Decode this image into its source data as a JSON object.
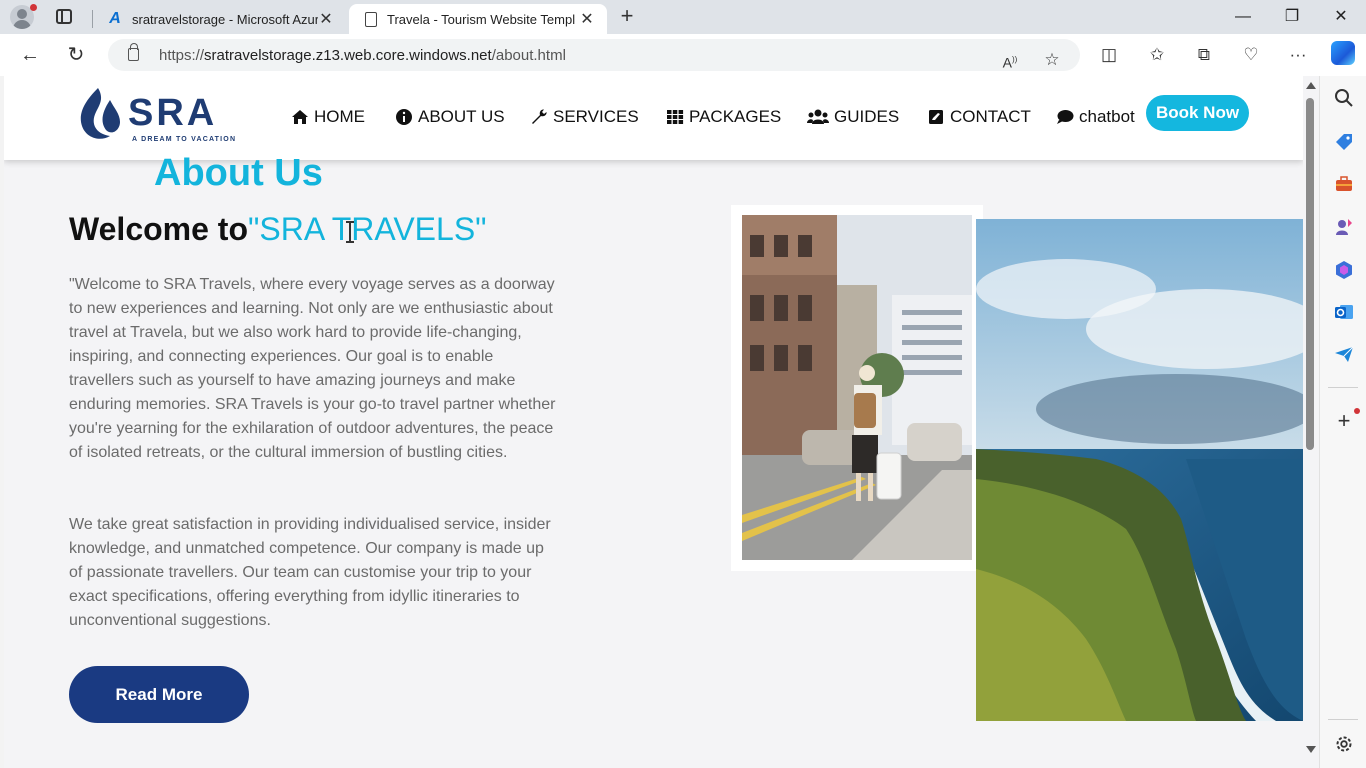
{
  "browser": {
    "tabs": [
      {
        "title": "sratravelstorage - Microsoft Azur",
        "favicon": "azure-icon"
      },
      {
        "title": "Travela - Tourism Website Templ",
        "favicon": "page-icon",
        "active": true
      }
    ],
    "url": {
      "scheme": "https://",
      "host": "sratravelstorage.z13.web.core.windows.net",
      "path": "/about.html"
    }
  },
  "site": {
    "logo": {
      "text": "SRA",
      "tagline": "A DREAM TO VACATION"
    },
    "nav": [
      {
        "label": "HOME",
        "icon": "home-icon"
      },
      {
        "label": "ABOUT US",
        "icon": "info-icon"
      },
      {
        "label": "SERVICES",
        "icon": "wrench-icon"
      },
      {
        "label": "PACKAGES",
        "icon": "grid-icon"
      },
      {
        "label": "GUIDES",
        "icon": "users-icon"
      },
      {
        "label": "CONTACT",
        "icon": "contact-icon"
      },
      {
        "label": "chatbot",
        "icon": "chat-icon"
      }
    ],
    "book_now": "Book Now"
  },
  "about": {
    "title": "About Us",
    "welcome_prefix": "Welcome to",
    "welcome_brand": "\"SRA TRAVELS\"",
    "paragraph1": "\"Welcome to SRA Travels, where every voyage serves as a doorway to new experiences and learning. Not only are we enthusiastic about travel at Travela, but we also work hard to provide life-changing, inspiring, and connecting experiences. Our goal is to enable travellers such as yourself to have amazing journeys and make enduring memories. SRA Travels is your go-to travel partner whether you're yearning for the exhilaration of outdoor adventures, the peace of isolated retreats, or the cultural immersion of bustling cities.",
    "paragraph2": "We take great satisfaction in providing individualised service, insider knowledge, and unmatched competence. Our company is made up of passionate travellers. Our team can customise your trip to your exact specifications, offering everything from idyllic itineraries to unconventional suggestions.",
    "read_more": "Read More"
  },
  "colors": {
    "accent": "#13b4dc",
    "brand_navy": "#1a3a82",
    "logo_navy": "#1f3c73",
    "body_text": "#6b6b6b"
  }
}
